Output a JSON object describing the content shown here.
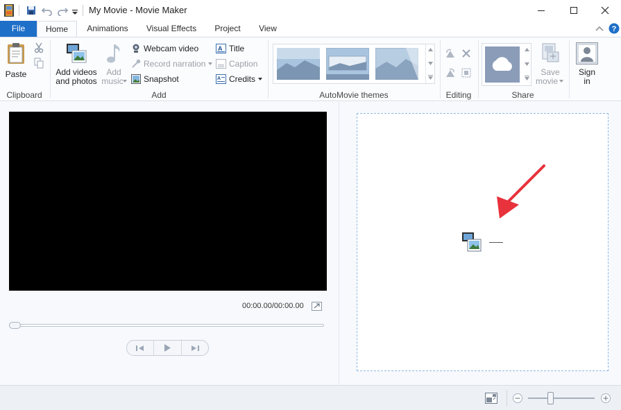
{
  "window": {
    "title": "My Movie - Movie Maker"
  },
  "tabs": [
    {
      "label": "File"
    },
    {
      "label": "Home"
    },
    {
      "label": "Animations"
    },
    {
      "label": "Visual Effects"
    },
    {
      "label": "Project"
    },
    {
      "label": "View"
    }
  ],
  "ribbon": {
    "clipboard": {
      "paste": "Paste",
      "group": "Clipboard"
    },
    "add": {
      "add_videos_line1": "Add videos",
      "add_videos_line2": "and photos",
      "add_music_line1": "Add",
      "add_music_line2": "music",
      "webcam": "Webcam video",
      "narration": "Record narration",
      "snapshot": "Snapshot",
      "title": "Title",
      "caption": "Caption",
      "credits": "Credits",
      "group": "Add"
    },
    "themes": {
      "group": "AutoMovie themes"
    },
    "editing": {
      "group": "Editing"
    },
    "share": {
      "save_line1": "Save",
      "save_line2": "movie",
      "group": "Share"
    },
    "signin": {
      "line1": "Sign",
      "line2": "in"
    }
  },
  "player": {
    "timecode": "00:00.00/00:00.00",
    "progress": 0
  },
  "statusbar": {
    "zoom_level": 0.33
  },
  "colors": {
    "file_tab": "#1e6fc8",
    "arrow": "#e8323c",
    "storyboard_border": "#8fb8e0"
  }
}
